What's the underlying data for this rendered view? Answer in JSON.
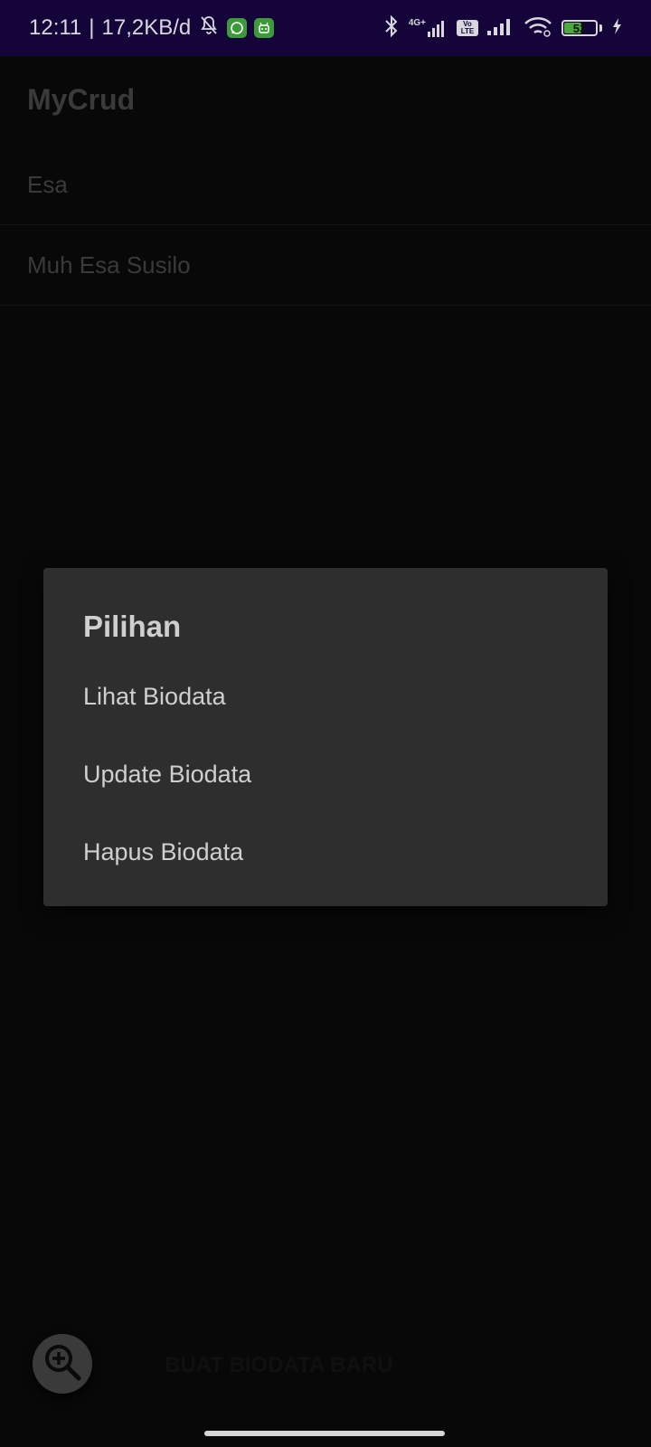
{
  "status_bar": {
    "time": "12:11",
    "separator": "|",
    "net_speed": "17,2KB/d",
    "icons": [
      "mute-bell-icon",
      "whatsapp-icon",
      "android-app-icon",
      "bluetooth-icon",
      "signal-4g-icon",
      "volte-icon",
      "signal-icon",
      "wifi-icon",
      "battery-icon",
      "charging-icon"
    ],
    "network_label": "4G+",
    "volte_label": "Vo LTE",
    "battery_level": "53",
    "battery_fraction": 0.53,
    "colors": {
      "background": "#14043a",
      "badge": "#3c9a3a",
      "battery_fill": "#4caa3a"
    }
  },
  "app": {
    "title": "MyCrud",
    "list": [
      "Esa",
      "Muh Esa Susilo"
    ]
  },
  "dialog": {
    "title": "Pilihan",
    "options": [
      "Lihat Biodata",
      "Update Biodata",
      "Hapus Biodata"
    ]
  },
  "bottom": {
    "fab_icon": "zoom-in-icon",
    "create_label": "BUAT BIODATA BARU"
  }
}
